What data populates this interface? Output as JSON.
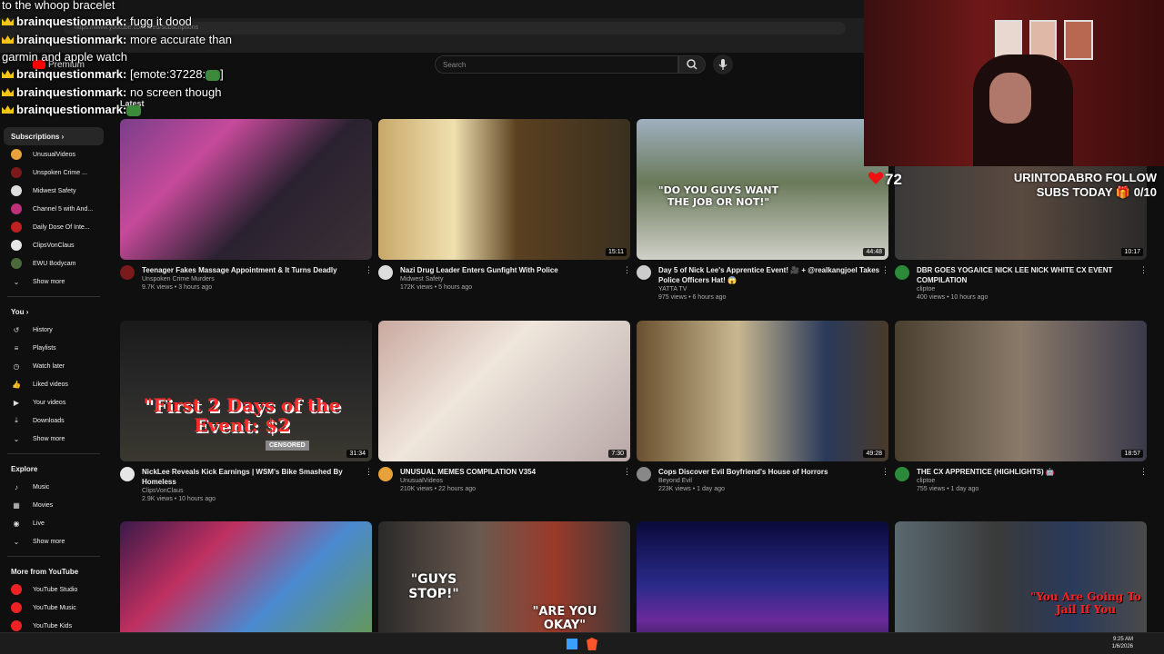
{
  "browser": {
    "url": "https://www.youtube.com/feed/subscriptions"
  },
  "header": {
    "logo_label": "Premium",
    "search_placeholder": "Search",
    "section_label": "Latest"
  },
  "chat": [
    {
      "user": "",
      "text": "to the whoop bracelet"
    },
    {
      "user": "brainquestionmark:",
      "text": " fugg it dood"
    },
    {
      "user": "brainquestionmark:",
      "text": " more accurate than"
    },
    {
      "user": "",
      "text": "garmin and apple watch"
    },
    {
      "user": "brainquestionmark:",
      "text": " [emote:37228:"
    },
    {
      "user": "brainquestionmark:",
      "text": " no screen though"
    },
    {
      "user": "brainquestionmark:",
      "text": ""
    }
  ],
  "emote_close": "]",
  "overlay": {
    "heart_count": "72",
    "follow_line1": "URINTODABRO FOLLOW",
    "follow_line2": "SUBS TODAY 🎁 0/10"
  },
  "sidebar": {
    "subscriptions_label": "Subscriptions",
    "subs": [
      {
        "label": "UnusualVideos",
        "color": "#e8a23a"
      },
      {
        "label": "Unspoken Crime ...",
        "color": "#7a1a1a"
      },
      {
        "label": "Midwest Safety",
        "color": "#ddd"
      },
      {
        "label": "Channel 5 with And...",
        "color": "#c0307a"
      },
      {
        "label": "Daily Dose Of Inte...",
        "color": "#c02020"
      },
      {
        "label": "ClipsVonClaus",
        "color": "#e6e6e6"
      },
      {
        "label": "EWU Bodycam",
        "color": "#4a6a3a"
      }
    ],
    "show_more": "Show more",
    "you_label": "You",
    "you_items": [
      {
        "label": "History",
        "icon": "↺"
      },
      {
        "label": "Playlists",
        "icon": "≡"
      },
      {
        "label": "Watch later",
        "icon": "◷"
      },
      {
        "label": "Liked videos",
        "icon": "👍"
      },
      {
        "label": "Your videos",
        "icon": "▶"
      },
      {
        "label": "Downloads",
        "icon": "⤓"
      },
      {
        "label": "Show more",
        "icon": "⌄"
      }
    ],
    "explore_label": "Explore",
    "explore_items": [
      {
        "label": "Music",
        "icon": "♪"
      },
      {
        "label": "Movies",
        "icon": "▦"
      },
      {
        "label": "Live",
        "icon": "◉"
      },
      {
        "label": "Show more",
        "icon": "⌄"
      }
    ],
    "more_label": "More from YouTube",
    "more_items": [
      {
        "label": "YouTube Studio"
      },
      {
        "label": "YouTube Music"
      },
      {
        "label": "YouTube Kids"
      }
    ]
  },
  "videos": [
    {
      "title": "Teenager Fakes Massage Appointment & It Turns Deadly",
      "channel": "Unspoken Crime Murders",
      "stats": "9.7K views • 3 hours ago",
      "duration": "",
      "avatar": "#7a1a1a",
      "thumb": "linear-gradient(135deg,#7a3e8a 0%,#c64a9a 30%,#2a2230 60%,#3a3035 100%)"
    },
    {
      "title": "Nazi Drug Leader Enters Gunfight With Police",
      "channel": "Midwest Safety",
      "stats": "172K views • 5 hours ago",
      "duration": "15:11",
      "avatar": "#ddd",
      "thumb": "linear-gradient(90deg,#c8a86a 0%,#efe0b0 30%,#5a4020 55%,#3a3020 100%)"
    },
    {
      "title": "Day 5 of Nick Lee's Apprentice Event! 🎥 + @realkangjoel Takes Police Officers Hat! 😱",
      "channel": "YATTA TV",
      "stats": "975 views • 6 hours ago",
      "duration": "44:48",
      "avatar": "#ccc",
      "thumb": "linear-gradient(180deg,#9fb0c0 0%,#6a7a5a 45%,#d0d0c8 100%)"
    },
    {
      "title": "DBR GOES YOGA/ICE NICK LEE NICK WHITE CX EVENT COMPILATION",
      "channel": "cliptoe",
      "stats": "400 views • 10 hours ago",
      "duration": "10:17",
      "avatar": "#2a8a3a",
      "thumb": "linear-gradient(90deg,#3a3a3a 0%,#5a4a40 50%,#2a2a2a 100%)"
    },
    {
      "title": "NickLee Reveals Kick Earnings | WSM's Bike Smashed By Homeless",
      "channel": "ClipsVonClaus",
      "stats": "2.9K views • 10 hours ago",
      "duration": "31:34",
      "avatar": "#e6e6e6",
      "thumb": "linear-gradient(180deg,#1a1a1a 0%,#2a2a2a 50%,#3a3830 100%)"
    },
    {
      "title": "UNUSUAL MEMES COMPILATION V354",
      "channel": "UnusualVideos",
      "stats": "210K views • 22 hours ago",
      "duration": "7:30",
      "avatar": "#e8a23a",
      "thumb": "linear-gradient(135deg,#c9a9a0 0%,#efe6dc 40%,#b8a8a8 100%)"
    },
    {
      "title": "Cops Discover Evil Boyfriend's House of Horrors",
      "channel": "Beyond Evil",
      "stats": "223K views • 1 day ago",
      "duration": "49:28",
      "avatar": "#888",
      "thumb": "linear-gradient(90deg,#6a5030 0%,#c8b890 40%,#2a3a5a 75%,#4a3a2a 100%)"
    },
    {
      "title": "THE CX APPRENTICE (HIGHLIGHTS) 🤖",
      "channel": "cliptoe",
      "stats": "755 views • 1 day ago",
      "duration": "18:57",
      "avatar": "#2a8a3a",
      "thumb": "linear-gradient(90deg,#4a4030 0%,#8a7a6a 50%,#3a3a4a 100%)"
    },
    {
      "title": "",
      "channel": "",
      "stats": "",
      "duration": "",
      "avatar": "",
      "thumb": "linear-gradient(135deg,#3a1a4a 0%,#c03060 30%,#4a8ad0 60%,#6a9a40 100%)"
    },
    {
      "title": "",
      "channel": "",
      "stats": "",
      "duration": "",
      "avatar": "",
      "thumb": "linear-gradient(90deg,#2a2a2a 0%,#6a5a50 40%,#9a3a2a 70%,#3a3a3a 100%)"
    },
    {
      "title": "",
      "channel": "",
      "stats": "",
      "duration": "",
      "avatar": "",
      "thumb": "linear-gradient(180deg,#0a0a3a 0%,#2a2a8a 45%,#6a2a9a 70%,#1a1a2a 100%)"
    },
    {
      "title": "",
      "channel": "",
      "stats": "",
      "duration": "",
      "avatar": "",
      "thumb": "linear-gradient(90deg,#5a6a70 0%,#3a3a3a 40%,#2a3a5a 70%,#4a4a4a 100%)"
    }
  ],
  "thumb_text": {
    "v3": "\"DO YOU GUYS WANT THE JOB OR NOT!\"",
    "v5": "\"First 2 Days of the Event: $2",
    "v5_censor": "CENSORED",
    "v10a": "\"GUYS STOP!\"",
    "v10b": "\"ARE YOU OKAY\"",
    "v12": "\"You Are Going To Jail If You"
  },
  "taskbar": {
    "time": "9:25 AM",
    "date": "1/6/2026"
  }
}
